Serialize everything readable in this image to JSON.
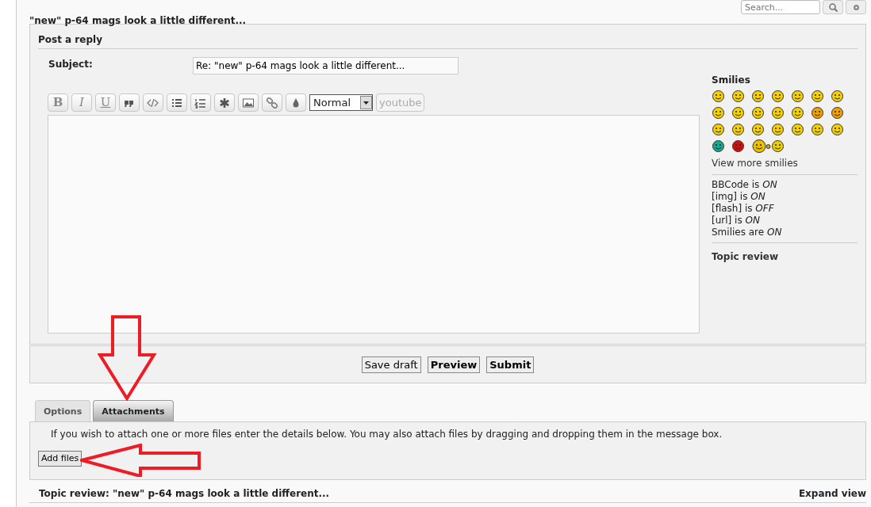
{
  "search": {
    "placeholder": "Search..."
  },
  "topic_title": "\"new\" p-64 mags look a little different...",
  "post": {
    "heading": "Post a reply",
    "subject_label": "Subject:",
    "subject_value": "Re: \"new\" p-64 mags look a little different..."
  },
  "toolbar": [
    {
      "kind": "bold",
      "label": "B"
    },
    {
      "kind": "italic",
      "label": "I"
    },
    {
      "kind": "underline",
      "label": "U"
    },
    {
      "kind": "quote"
    },
    {
      "kind": "code"
    },
    {
      "kind": "list"
    },
    {
      "kind": "numlist"
    },
    {
      "kind": "star"
    },
    {
      "kind": "image"
    },
    {
      "kind": "link"
    },
    {
      "kind": "drop"
    }
  ],
  "font_size": "Normal",
  "youtube_button": "youtube",
  "smilies_heading": "Smilies",
  "smilies": [
    {
      "color": "#f5d000"
    },
    {
      "color": "#f5d000"
    },
    {
      "color": "#f5d000"
    },
    {
      "color": "#f5d000"
    },
    {
      "color": "#f5d000"
    },
    {
      "color": "#f5d000"
    },
    {
      "color": "#f5d000"
    },
    {
      "color": "#f5d000"
    },
    {
      "color": "#f5d000"
    },
    {
      "color": "#f5d000"
    },
    {
      "color": "#f5d000"
    },
    {
      "color": "#f5d000"
    },
    {
      "color": "#f0a000"
    },
    {
      "color": "#f0a000"
    },
    {
      "color": "#f5d000"
    },
    {
      "color": "#f5d000"
    },
    {
      "color": "#f5d000"
    },
    {
      "color": "#f5d000"
    },
    {
      "color": "#f5d000"
    },
    {
      "color": "#f5d000"
    },
    {
      "color": "#f5d000"
    },
    {
      "color": "#18a890"
    },
    {
      "color": "#d01010"
    },
    {
      "color": "#e8c000"
    },
    {
      "color": "#e8d000"
    }
  ],
  "view_more": "View more smilies",
  "status_lines": [
    "BBCode is *ON*",
    "[img] is *ON*",
    "[flash] is *OFF*",
    "[url] is *ON*",
    "Smilies are *ON*"
  ],
  "topic_review_link": "Topic review",
  "buttons": [
    {
      "label": "Save draft",
      "kind": "secondary"
    },
    {
      "label": "Preview",
      "kind": "primary"
    },
    {
      "label": "Submit",
      "kind": "primary"
    }
  ],
  "tabs": [
    {
      "label": "Options",
      "selected": false
    },
    {
      "label": "Attachments",
      "selected": true
    }
  ],
  "attach_text": "If you wish to attach one or more files enter the details below. You may also attach files by dragging and dropping them in the message box.",
  "add_files": "Add files",
  "review_heading": "Topic review: \"new\" p-64 mags look a little different...",
  "expand_view": "Expand view"
}
